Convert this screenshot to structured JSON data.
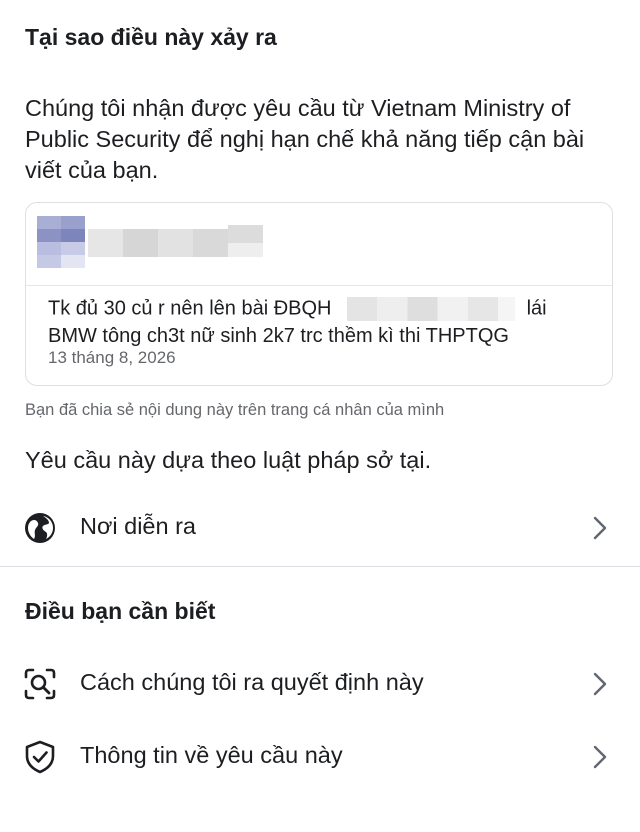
{
  "why": {
    "title": "Tại sao điều này xảy ra",
    "body": "Chúng tôi nhận được yêu cầu từ Vietnam Ministry of Public Security để nghị hạn chế khả năng tiếp cận bài viết của bạn."
  },
  "post": {
    "line1_before": "Tk đủ 30 củ r nên lên bài ĐBQH",
    "line1_after": "lái",
    "line2": "BMW tông ch3t nữ sinh 2k7 trc thềm kì thi THPTQG",
    "date": "13 tháng 8, 2026"
  },
  "share_note": "Bạn đã chia sẻ nội dung này trên trang cá nhân của mình",
  "law_text": "Yêu cầu này dựa theo luật pháp sở tại.",
  "where_row": {
    "label": "Nơi diễn ra",
    "icon": "globe-icon"
  },
  "know": {
    "title": "Điều bạn cần biết",
    "items": [
      {
        "label": "Cách chúng tôi ra quyết định này",
        "icon": "search-scan-icon"
      },
      {
        "label": "Thông tin về yêu cầu này",
        "icon": "shield-check-icon"
      }
    ]
  }
}
